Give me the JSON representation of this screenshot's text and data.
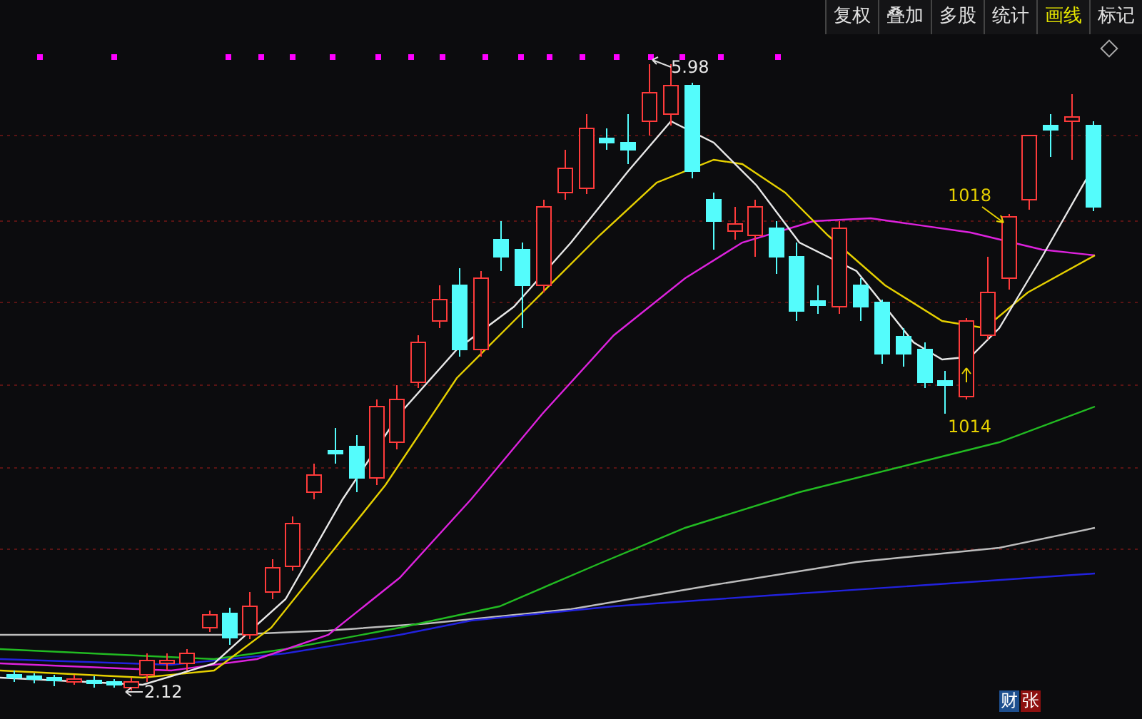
{
  "toolbar": {
    "tabs": [
      {
        "label": "复权",
        "selected": false
      },
      {
        "label": "叠加",
        "selected": false
      },
      {
        "label": "多股",
        "selected": false
      },
      {
        "label": "统计",
        "selected": false
      },
      {
        "label": "画线",
        "selected": true
      },
      {
        "label": "标记",
        "selected": false
      }
    ]
  },
  "chart": {
    "annotations": [
      {
        "kind": "high",
        "text": "5.98"
      },
      {
        "kind": "low",
        "text": "2.12"
      },
      {
        "kind": "marker",
        "text": "1018"
      },
      {
        "kind": "marker",
        "text": "1014"
      }
    ]
  },
  "badges": [
    {
      "label": "财",
      "color": "#1e4f8f"
    },
    {
      "label": "张",
      "color": "#8e1010"
    }
  ]
}
